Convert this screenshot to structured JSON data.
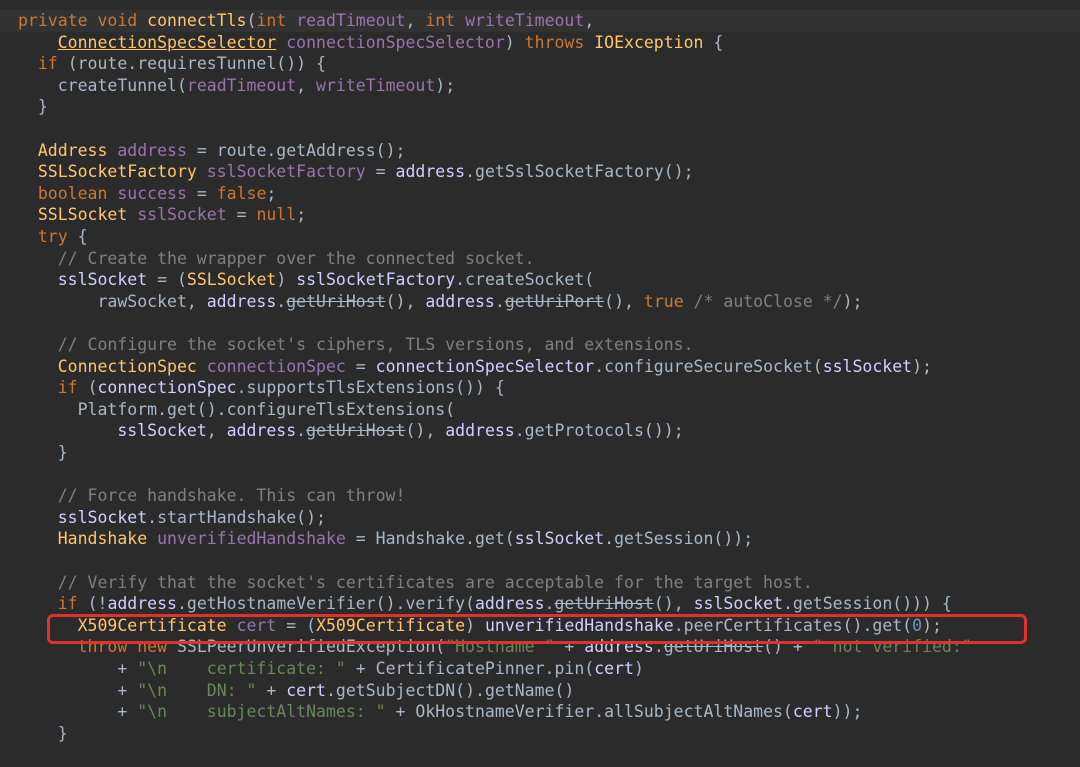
{
  "editor": {
    "lines": [
      {
        "tokens": [
          {
            "t": "private ",
            "c": "kw"
          },
          {
            "t": "void ",
            "c": "kw"
          },
          {
            "t": "connectTls",
            "c": "fn"
          },
          {
            "t": "(",
            "c": "plain"
          },
          {
            "t": "int ",
            "c": "kw"
          },
          {
            "t": "readTimeout",
            "c": "var"
          },
          {
            "t": ", ",
            "c": "plain"
          },
          {
            "t": "int ",
            "c": "kw"
          },
          {
            "t": "writeTimeout",
            "c": "var"
          },
          {
            "t": ",",
            "c": "plain"
          }
        ]
      },
      {
        "tokens": [
          {
            "t": "    ",
            "c": "plain"
          },
          {
            "t": "ConnectionSpecSelector",
            "c": "cls-u"
          },
          {
            "t": " ",
            "c": "plain"
          },
          {
            "t": "connectionSpecSelector",
            "c": "var"
          },
          {
            "t": ") ",
            "c": "plain"
          },
          {
            "t": "throws ",
            "c": "kw"
          },
          {
            "t": "IOException",
            "c": "cls"
          },
          {
            "t": " {",
            "c": "plain"
          }
        ]
      },
      {
        "tokens": [
          {
            "t": "  ",
            "c": "plain"
          },
          {
            "t": "if ",
            "c": "kw"
          },
          {
            "t": "(route.requiresTunnel()) {",
            "c": "plain"
          }
        ]
      },
      {
        "tokens": [
          {
            "t": "    createTunnel(",
            "c": "plain"
          },
          {
            "t": "readTimeout",
            "c": "var"
          },
          {
            "t": ", ",
            "c": "plain"
          },
          {
            "t": "writeTimeout",
            "c": "var"
          },
          {
            "t": ");",
            "c": "plain"
          }
        ]
      },
      {
        "tokens": [
          {
            "t": "  }",
            "c": "plain"
          }
        ]
      },
      {
        "tokens": [
          {
            "t": "",
            "c": "plain"
          }
        ]
      },
      {
        "tokens": [
          {
            "t": "  ",
            "c": "plain"
          },
          {
            "t": "Address",
            "c": "cls"
          },
          {
            "t": " ",
            "c": "plain"
          },
          {
            "t": "address",
            "c": "var"
          },
          {
            "t": " = route.getAddress();",
            "c": "plain"
          }
        ]
      },
      {
        "tokens": [
          {
            "t": "  ",
            "c": "plain"
          },
          {
            "t": "SSLSocketFactory",
            "c": "cls"
          },
          {
            "t": " ",
            "c": "plain"
          },
          {
            "t": "sslSocketFactory",
            "c": "var"
          },
          {
            "t": " = ",
            "c": "plain"
          },
          {
            "t": "address",
            "c": "field"
          },
          {
            "t": ".getSslSocketFactory();",
            "c": "plain"
          }
        ]
      },
      {
        "tokens": [
          {
            "t": "  ",
            "c": "plain"
          },
          {
            "t": "boolean ",
            "c": "kw"
          },
          {
            "t": "success",
            "c": "var"
          },
          {
            "t": " = ",
            "c": "plain"
          },
          {
            "t": "false",
            "c": "kw"
          },
          {
            "t": ";",
            "c": "plain"
          }
        ]
      },
      {
        "tokens": [
          {
            "t": "  ",
            "c": "plain"
          },
          {
            "t": "SSLSocket",
            "c": "cls"
          },
          {
            "t": " ",
            "c": "plain"
          },
          {
            "t": "sslSocket",
            "c": "var"
          },
          {
            "t": " = ",
            "c": "plain"
          },
          {
            "t": "null",
            "c": "kw"
          },
          {
            "t": ";",
            "c": "plain"
          }
        ]
      },
      {
        "tokens": [
          {
            "t": "  ",
            "c": "plain"
          },
          {
            "t": "try ",
            "c": "kw"
          },
          {
            "t": "{",
            "c": "plain"
          }
        ]
      },
      {
        "tokens": [
          {
            "t": "    // Create the wrapper over the connected socket.",
            "c": "cmt"
          }
        ]
      },
      {
        "tokens": [
          {
            "t": "    ",
            "c": "plain"
          },
          {
            "t": "sslSocket",
            "c": "field"
          },
          {
            "t": " = (",
            "c": "plain"
          },
          {
            "t": "SSLSocket",
            "c": "cls"
          },
          {
            "t": ") ",
            "c": "plain"
          },
          {
            "t": "sslSocketFactory",
            "c": "field"
          },
          {
            "t": ".createSocket(",
            "c": "plain"
          }
        ]
      },
      {
        "tokens": [
          {
            "t": "        rawSocket, ",
            "c": "plain"
          },
          {
            "t": "address",
            "c": "field"
          },
          {
            "t": ".",
            "c": "plain"
          },
          {
            "t": "getUriHost",
            "c": "strike"
          },
          {
            "t": "(), ",
            "c": "plain"
          },
          {
            "t": "address",
            "c": "field"
          },
          {
            "t": ".",
            "c": "plain"
          },
          {
            "t": "getUriPort",
            "c": "strike"
          },
          {
            "t": "(), ",
            "c": "plain"
          },
          {
            "t": "true ",
            "c": "kw"
          },
          {
            "t": "/* autoClose */",
            "c": "cmt"
          },
          {
            "t": ");",
            "c": "plain"
          }
        ]
      },
      {
        "tokens": [
          {
            "t": "",
            "c": "plain"
          }
        ]
      },
      {
        "tokens": [
          {
            "t": "    // Configure the socket's ciphers, TLS versions, and extensions.",
            "c": "cmt"
          }
        ]
      },
      {
        "tokens": [
          {
            "t": "    ",
            "c": "plain"
          },
          {
            "t": "ConnectionSpec",
            "c": "cls"
          },
          {
            "t": " ",
            "c": "plain"
          },
          {
            "t": "connectionSpec",
            "c": "var"
          },
          {
            "t": " = ",
            "c": "plain"
          },
          {
            "t": "connectionSpecSelector",
            "c": "field"
          },
          {
            "t": ".configureSecureSocket(",
            "c": "plain"
          },
          {
            "t": "sslSocket",
            "c": "field"
          },
          {
            "t": ");",
            "c": "plain"
          }
        ]
      },
      {
        "tokens": [
          {
            "t": "    ",
            "c": "plain"
          },
          {
            "t": "if ",
            "c": "kw"
          },
          {
            "t": "(",
            "c": "plain"
          },
          {
            "t": "connectionSpec",
            "c": "field"
          },
          {
            "t": ".supportsTlsExtensions()) {",
            "c": "plain"
          }
        ]
      },
      {
        "tokens": [
          {
            "t": "      Platform.get().configureTlsExtensions(",
            "c": "plain"
          }
        ]
      },
      {
        "tokens": [
          {
            "t": "          ",
            "c": "plain"
          },
          {
            "t": "sslSocket",
            "c": "field"
          },
          {
            "t": ", ",
            "c": "plain"
          },
          {
            "t": "address",
            "c": "field"
          },
          {
            "t": ".",
            "c": "plain"
          },
          {
            "t": "getUriHost",
            "c": "strike"
          },
          {
            "t": "(), ",
            "c": "plain"
          },
          {
            "t": "address",
            "c": "field"
          },
          {
            "t": ".getProtocols());",
            "c": "plain"
          }
        ]
      },
      {
        "tokens": [
          {
            "t": "    }",
            "c": "plain"
          }
        ]
      },
      {
        "tokens": [
          {
            "t": "",
            "c": "plain"
          }
        ]
      },
      {
        "tokens": [
          {
            "t": "    // Force handshake. This can throw!",
            "c": "cmt"
          }
        ]
      },
      {
        "tokens": [
          {
            "t": "    ",
            "c": "plain"
          },
          {
            "t": "sslSocket",
            "c": "field"
          },
          {
            "t": ".startHandshake();",
            "c": "plain"
          }
        ]
      },
      {
        "tokens": [
          {
            "t": "    ",
            "c": "plain"
          },
          {
            "t": "Handshake",
            "c": "cls"
          },
          {
            "t": " ",
            "c": "plain"
          },
          {
            "t": "unverifiedHandshake",
            "c": "var"
          },
          {
            "t": " = Handshake.get(",
            "c": "plain"
          },
          {
            "t": "sslSocket",
            "c": "field"
          },
          {
            "t": ".getSession());",
            "c": "plain"
          }
        ]
      },
      {
        "tokens": [
          {
            "t": "",
            "c": "plain"
          }
        ]
      },
      {
        "tokens": [
          {
            "t": "    // Verify that the socket's certificates are acceptable for the target host.",
            "c": "cmt"
          }
        ]
      },
      {
        "tokens": [
          {
            "t": "    ",
            "c": "plain"
          },
          {
            "t": "if ",
            "c": "kw"
          },
          {
            "t": "(!",
            "c": "plain"
          },
          {
            "t": "address",
            "c": "field"
          },
          {
            "t": ".getHostnameVerifier().verify(",
            "c": "plain"
          },
          {
            "t": "address",
            "c": "field"
          },
          {
            "t": ".",
            "c": "plain"
          },
          {
            "t": "getUriHost",
            "c": "strike"
          },
          {
            "t": "(), ",
            "c": "plain"
          },
          {
            "t": "sslSocket",
            "c": "field"
          },
          {
            "t": ".getSession())) {",
            "c": "plain"
          }
        ]
      },
      {
        "tokens": [
          {
            "t": "      ",
            "c": "plain"
          },
          {
            "t": "X509Certificate",
            "c": "cls"
          },
          {
            "t": " ",
            "c": "plain"
          },
          {
            "t": "cert",
            "c": "var"
          },
          {
            "t": " = (",
            "c": "plain"
          },
          {
            "t": "X509Certificate",
            "c": "cls"
          },
          {
            "t": ") ",
            "c": "plain"
          },
          {
            "t": "unverifiedHandshake",
            "c": "field"
          },
          {
            "t": ".peerCertificates().get(",
            "c": "plain"
          },
          {
            "t": "0",
            "c": "num"
          },
          {
            "t": ");",
            "c": "plain"
          }
        ]
      },
      {
        "tokens": [
          {
            "t": "      ",
            "c": "plain"
          },
          {
            "t": "throw ",
            "c": "kw"
          },
          {
            "t": "new ",
            "c": "kw"
          },
          {
            "t": "SSLPeerUnverifiedException",
            "c": "plain"
          },
          {
            "t": "(",
            "c": "plain"
          },
          {
            "t": "\"Hostname \"",
            "c": "str"
          },
          {
            "t": " + ",
            "c": "plain"
          },
          {
            "t": "address",
            "c": "field"
          },
          {
            "t": ".",
            "c": "plain"
          },
          {
            "t": "getUriHost",
            "c": "strike"
          },
          {
            "t": "() + ",
            "c": "plain"
          },
          {
            "t": "\" not verified:\"",
            "c": "str"
          }
        ]
      },
      {
        "tokens": [
          {
            "t": "          + ",
            "c": "plain"
          },
          {
            "t": "\"\\n    certificate: \"",
            "c": "str"
          },
          {
            "t": " + CertificatePinner.pin(",
            "c": "plain"
          },
          {
            "t": "cert",
            "c": "field"
          },
          {
            "t": ")",
            "c": "plain"
          }
        ]
      },
      {
        "tokens": [
          {
            "t": "          + ",
            "c": "plain"
          },
          {
            "t": "\"\\n    DN: \"",
            "c": "str"
          },
          {
            "t": " + ",
            "c": "plain"
          },
          {
            "t": "cert",
            "c": "field"
          },
          {
            "t": ".getSubjectDN().getName()",
            "c": "plain"
          }
        ]
      },
      {
        "tokens": [
          {
            "t": "          + ",
            "c": "plain"
          },
          {
            "t": "\"\\n    subjectAltNames: \"",
            "c": "str"
          },
          {
            "t": " + OkHostnameVerifier.allSubjectAltNames(",
            "c": "plain"
          },
          {
            "t": "cert",
            "c": "field"
          },
          {
            "t": "));",
            "c": "plain"
          }
        ]
      },
      {
        "tokens": [
          {
            "t": "    }",
            "c": "plain"
          }
        ]
      }
    ]
  },
  "colors": {
    "background": "#2b2b2b",
    "keyword": "#cc7832",
    "class": "#ffc66d",
    "variable": "#9876aa",
    "string": "#6a8759",
    "comment": "#808080",
    "number": "#6897bb",
    "highlight_box": "#e0312b"
  }
}
